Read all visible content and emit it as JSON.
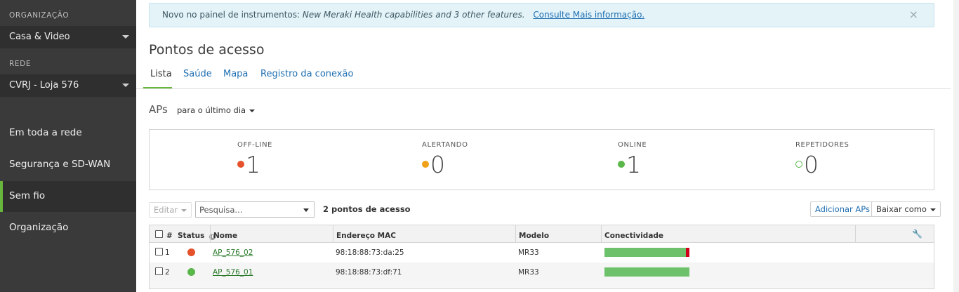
{
  "sidebar": {
    "org_label": "ORGANIZAÇÃO",
    "org_value": "Casa & Video",
    "network_label": "REDE",
    "network_value": "CVRJ - Loja 576",
    "items": [
      {
        "label": "Em toda a rede"
      },
      {
        "label": "Segurança e SD-WAN"
      },
      {
        "label": "Sem fio"
      },
      {
        "label": "Organização"
      }
    ],
    "active_item": "Sem fio",
    "accent_color": "#67b73f"
  },
  "banner": {
    "prefix": "Novo no painel de instrumentos:",
    "italic": "New Meraki Health capabilities and 3 other features.",
    "link": "Consulte Mais informação.",
    "close": "×"
  },
  "page": {
    "title": "Pontos de acesso",
    "tabs": [
      {
        "label": "Lista"
      },
      {
        "label": "Saúde"
      },
      {
        "label": "Mapa"
      },
      {
        "label": "Registro da conexão"
      }
    ],
    "active_tab": "Lista"
  },
  "aps": {
    "title": "APs",
    "period": "para o último dia"
  },
  "stats": [
    {
      "label": "OFF-LINE",
      "value": "1",
      "color": "#e5512b",
      "hollow": false
    },
    {
      "label": "ALERTANDO",
      "value": "0",
      "color": "#f0a11a",
      "hollow": false
    },
    {
      "label": "ONLINE",
      "value": "1",
      "color": "#5ab84a",
      "hollow": false
    },
    {
      "label": "REPETIDORES",
      "value": "0",
      "color": "#5ab84a",
      "hollow": true
    }
  ],
  "toolbar": {
    "edit": "Editar",
    "search_placeholder": "Pesquisa...",
    "count": "2 pontos de acesso",
    "add": "Adicionar APs",
    "download": "Baixar como"
  },
  "table": {
    "columns": [
      "#",
      "Status",
      "Nome",
      "Endereço MAC",
      "Modelo",
      "Conectividade"
    ],
    "status_info_icon": "info-icon",
    "settings_icon": "wrench-icon",
    "rows": [
      {
        "num": "1",
        "status_color": "#e5512b",
        "name": "AP_576_02",
        "mac": "98:18:88:73:da:25",
        "model": "MR33",
        "conn_bad_fraction": 0.04
      },
      {
        "num": "2",
        "status_color": "#5ab84a",
        "name": "AP_576_01",
        "mac": "98:18:88:73:df:71",
        "model": "MR33",
        "conn_bad_fraction": 0
      }
    ]
  }
}
